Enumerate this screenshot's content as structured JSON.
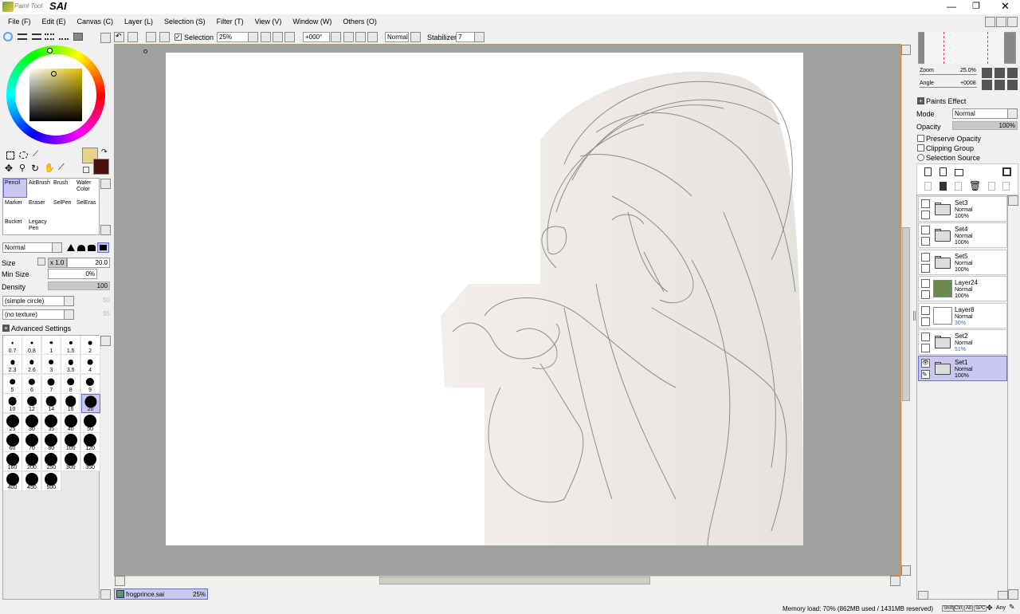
{
  "app": {
    "title": "Paint Tool",
    "brand": "SAI"
  },
  "menu": [
    "File (F)",
    "Edit (E)",
    "Canvas (C)",
    "Layer (L)",
    "Selection (S)",
    "Filter (T)",
    "View (V)",
    "Window (W)",
    "Others (O)"
  ],
  "toolbar": {
    "selection_label": "Selection",
    "zoom": "25%",
    "angle": "+000°",
    "blend": "Normal",
    "stabilizer_label": "Stabilizer",
    "stabilizer": "7"
  },
  "brush": {
    "mode": "Normal",
    "size_label": "Size",
    "size_mult": "x 1.0",
    "size": "20.0",
    "minsize_label": "Min Size",
    "minsize": "0%",
    "density_label": "Density",
    "density": "100",
    "shape": "(simple circle)",
    "shape_val": "50",
    "texture": "(no texture)",
    "texture_val": "95",
    "advanced": "Advanced Settings"
  },
  "tools": [
    {
      "name": "Pencil",
      "label": "Pencil"
    },
    {
      "name": "AirBrush",
      "label": "AirBrush"
    },
    {
      "name": "Brush",
      "label": "Brush"
    },
    {
      "name": "Water Color",
      "label": "Water Color"
    },
    {
      "name": "Marker",
      "label": "Marker"
    },
    {
      "name": "Eraser",
      "label": "Eraser"
    },
    {
      "name": "SelPen",
      "label": "SelPen"
    },
    {
      "name": "SelEras",
      "label": "SelEras"
    },
    {
      "name": "Bucket",
      "label": "Bucket"
    },
    {
      "name": "Legacy Pen",
      "label": "Legacy Pen"
    }
  ],
  "brush_sizes": [
    "0.7",
    "0.8",
    "1",
    "1.5",
    "2",
    "2.3",
    "2.6",
    "3",
    "3.5",
    "4",
    "5",
    "6",
    "7",
    "8",
    "9",
    "10",
    "12",
    "14",
    "16",
    "20",
    "25",
    "30",
    "35",
    "40",
    "50",
    "60",
    "70",
    "80",
    "100",
    "120",
    "160",
    "200",
    "250",
    "300",
    "350",
    "400",
    "450",
    "500"
  ],
  "selected_size": "20",
  "navigator": {
    "zoom_label": "Zoom",
    "zoom": "25.0%",
    "angle_label": "Angle",
    "angle": "+0008"
  },
  "layer_panel": {
    "paints_effect": "Paints Effect",
    "mode_label": "Mode",
    "mode": "Normal",
    "opacity_label": "Opacity",
    "opacity": "100%",
    "preserve": "Preserve Opacity",
    "clipping": "Clipping Group",
    "selsource": "Selection Source"
  },
  "layers": [
    {
      "name": "Set3",
      "mode": "Normal",
      "opacity": "100%",
      "type": "folder"
    },
    {
      "name": "Set4",
      "mode": "Normal",
      "opacity": "100%",
      "type": "folder"
    },
    {
      "name": "Set5",
      "mode": "Normal",
      "opacity": "100%",
      "type": "folder"
    },
    {
      "name": "Layer24",
      "mode": "Normal",
      "opacity": "100%",
      "type": "layer",
      "color": "#6b8a4e"
    },
    {
      "name": "Layer8",
      "mode": "Normal",
      "opacity": "30%",
      "type": "layer",
      "color": "#ffffff"
    },
    {
      "name": "Set2",
      "mode": "Normal",
      "opacity": "51%",
      "type": "folder"
    },
    {
      "name": "Set1",
      "mode": "Normal",
      "opacity": "100%",
      "type": "folder"
    }
  ],
  "file_tab": {
    "name": "frogprince.sai",
    "zoom": "25%"
  },
  "status": {
    "memory": "Memory load: 70% (862MB used / 1431MB reserved)",
    "keys": [
      "Shift",
      "Ctrl",
      "Alt",
      "SPC"
    ],
    "any": "Any"
  },
  "colors": {
    "primary": "#e6d38a",
    "secondary": "#4a1010",
    "accent_sel": "#c8c8f0",
    "canvas_bg": "#a0a0a0"
  }
}
